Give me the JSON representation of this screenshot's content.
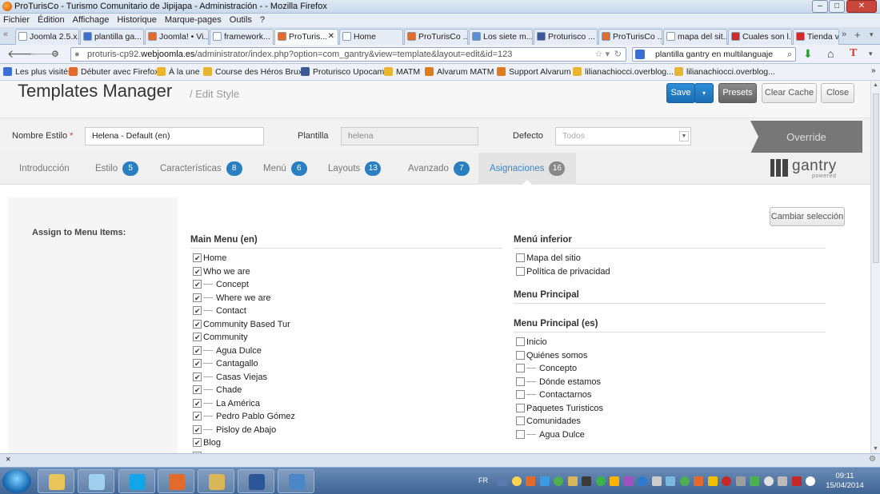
{
  "window": {
    "title": "ProTurisCo - Turismo Comunitario de Jipijapa - Administración - - Mozilla Firefox"
  },
  "menubar": [
    "Fichier",
    "Édition",
    "Affichage",
    "Historique",
    "Marque-pages",
    "Outils",
    "?"
  ],
  "browser_tabs": [
    {
      "label": "Joomla 2.5.x...",
      "color": "#ffffff"
    },
    {
      "label": "plantilla ga...",
      "color": "#3b6fd4"
    },
    {
      "label": "Joomla! • Vi...",
      "color": "#e26a2c"
    },
    {
      "label": "framework...",
      "color": "#ffffff"
    },
    {
      "label": "ProTuris...",
      "color": "#e26a2c",
      "active": true
    },
    {
      "label": "Home",
      "color": "#ffffff"
    },
    {
      "label": "ProTurisCo ...",
      "color": "#e26a2c"
    },
    {
      "label": "Los siete m...",
      "color": "#5a8fd8"
    },
    {
      "label": "Proturisco ...",
      "color": "#3b5998"
    },
    {
      "label": "ProTurisCo ...",
      "color": "#e26a2c"
    },
    {
      "label": "mapa del sit...",
      "color": "#ffffff"
    },
    {
      "label": "Cuales son l...",
      "color": "#d42a2a"
    },
    {
      "label": "Tienda vai",
      "color": "#d42a2a"
    }
  ],
  "nav": {
    "url_prefix": "proturis-cp92.",
    "url_domain": "webjoomla.es",
    "url_rest": "/administrator/index.php?option=com_gantry&view=template&layout=edit&id=123",
    "search_text": "plantilla gantry en multilanguaje"
  },
  "bookmarks": [
    "Les plus visités",
    "Débuter avec Firefox",
    "À la une",
    "Course des Héros Brux...",
    "Proturisco Upocam",
    "MATM",
    "Alvarum MATM",
    "Support Alvarum",
    "lilianachiocci.overblog...",
    "lilianachiocci.overblog..."
  ],
  "page": {
    "title": "Templates Manager",
    "subtitle": "/ Edit Style"
  },
  "toolbar": {
    "save": "Save",
    "presets": "Presets",
    "clear_cache": "Clear Cache",
    "close": "Close"
  },
  "form": {
    "style_label": "Nombre Estilo",
    "required_mark": "*",
    "style_value": "Helena - Default (en)",
    "template_label": "Plantilla",
    "template_value": "helena",
    "default_label": "Defecto",
    "default_value": "Todos",
    "override_label": "Override"
  },
  "panel_tabs": [
    {
      "label": "Introducción",
      "count": ""
    },
    {
      "label": "Estilo",
      "count": "5"
    },
    {
      "label": "Características",
      "count": "8"
    },
    {
      "label": "Menú",
      "count": "6"
    },
    {
      "label": "Layouts",
      "count": "13"
    },
    {
      "label": "Avanzado",
      "count": "7"
    },
    {
      "label": "Asignaciones",
      "count": "16",
      "active": true
    }
  ],
  "gantry": {
    "logo": "gantry",
    "powered": "powered"
  },
  "assign": {
    "label": "Assign to Menu Items:",
    "change_button": "Cambiar selección",
    "main_menu": {
      "title": "Main Menu (en)",
      "items": [
        {
          "label": "Home",
          "checked": true,
          "child": false
        },
        {
          "label": "Who we are",
          "checked": true,
          "child": false
        },
        {
          "label": "Concept",
          "checked": true,
          "child": true
        },
        {
          "label": "Where we are",
          "checked": true,
          "child": true
        },
        {
          "label": "Contact",
          "checked": true,
          "child": true
        },
        {
          "label": "Community Based Tur",
          "checked": true,
          "child": false
        },
        {
          "label": "Community",
          "checked": true,
          "child": false
        },
        {
          "label": "Agua Dulce",
          "checked": true,
          "child": true
        },
        {
          "label": "Cantagallo",
          "checked": true,
          "child": true
        },
        {
          "label": "Casas Viejas",
          "checked": true,
          "child": true
        },
        {
          "label": "Chade",
          "checked": true,
          "child": true
        },
        {
          "label": "La América",
          "checked": true,
          "child": true
        },
        {
          "label": "Pedro Pablo Gómez",
          "checked": true,
          "child": true
        },
        {
          "label": "Pisloy de Abajo",
          "checked": true,
          "child": true
        },
        {
          "label": "Blog",
          "checked": true,
          "child": false
        }
      ]
    },
    "menu_inferior": {
      "title": "Menú inferior",
      "items": [
        {
          "label": "Mapa del sitio",
          "checked": false,
          "child": false
        },
        {
          "label": "Política de privacidad",
          "checked": false,
          "child": false
        }
      ]
    },
    "menu_principal": {
      "title": "Menu Principal"
    },
    "menu_principal_es": {
      "title": "Menu Principal (es)",
      "items": [
        {
          "label": "Inicio",
          "checked": false,
          "child": false
        },
        {
          "label": "Quiénes somos",
          "checked": false,
          "child": false
        },
        {
          "label": "Concepto",
          "checked": false,
          "child": true
        },
        {
          "label": "Dónde estamos",
          "checked": false,
          "child": true
        },
        {
          "label": "Contactarnos",
          "checked": false,
          "child": true
        },
        {
          "label": "Paquetes Turisticos",
          "checked": false,
          "child": false
        },
        {
          "label": "Comunidades",
          "checked": false,
          "child": false
        },
        {
          "label": "Agua Dulce",
          "checked": false,
          "child": true
        }
      ]
    }
  },
  "taskbar": {
    "lang": "FR",
    "time": "09:11",
    "date": "15/04/2014"
  }
}
